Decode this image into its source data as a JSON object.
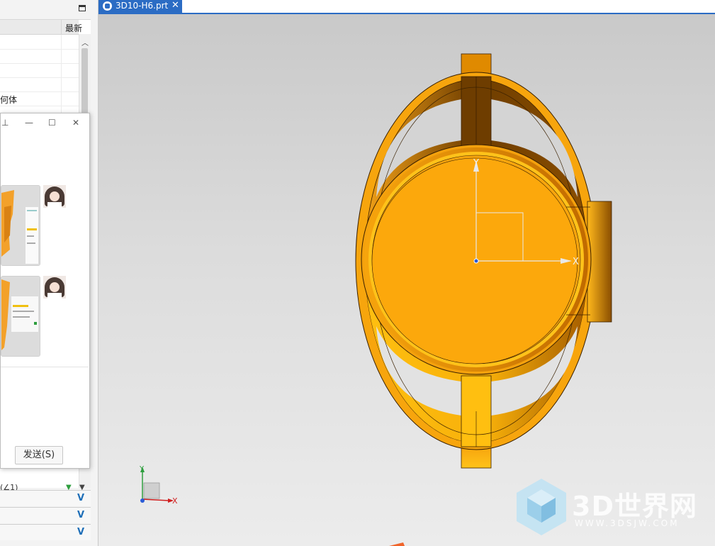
{
  "left_panel": {
    "column_header": "最新",
    "tree_rows": [
      "",
      "",
      "",
      "",
      "何体",
      ""
    ],
    "section_chevrons": [
      "V",
      "V",
      "V"
    ],
    "partial_row_text": "(∠1)"
  },
  "chat_window": {
    "send_label": "发送(S)",
    "title_icons": [
      "pin-icon",
      "minimize-icon",
      "maximize-icon",
      "close-icon"
    ]
  },
  "tab": {
    "label": "3D10-H6.prt",
    "close_glyph": "✕"
  },
  "viewport": {
    "axis_y": "Y",
    "axis_x": "X",
    "triad_y": "Y",
    "triad_x": "X",
    "model_color": "#F7A50D",
    "model_dark": "#8A4E00"
  },
  "watermark": {
    "text": "3D世界网",
    "url": "WWW.3DSJW.COM"
  }
}
